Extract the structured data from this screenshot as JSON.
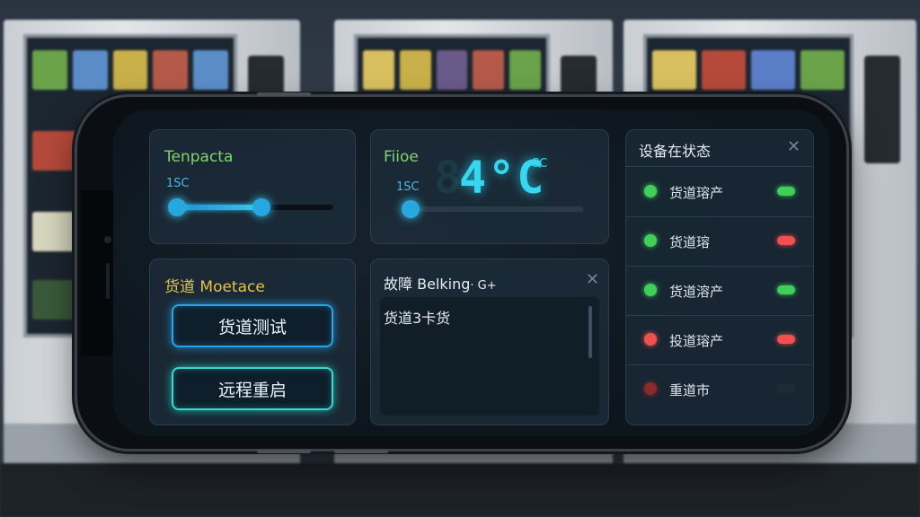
{
  "temp_panel": {
    "title": "Tenpacta",
    "value_label": "1SC",
    "slider_level": 0.48
  },
  "display_panel": {
    "title": "Fiioe",
    "value_label": "1SC",
    "temp_display": "4°C",
    "unit": "CC",
    "slider_level": 0.0
  },
  "channel_panel": {
    "title": "货道 Moetace",
    "test_button": "货道测试",
    "restart_button": "远程重启"
  },
  "fault_panel": {
    "title": "故障 Belking",
    "title_suffix": "· G+",
    "message": "货道3卡货"
  },
  "status_panel": {
    "title": "设备在状态",
    "items": [
      {
        "label": "货道瑢产",
        "dot_color": "#3fd05a",
        "pill_color": "#3fd05a"
      },
      {
        "label": "货道瑢",
        "dot_color": "#3fd05a",
        "pill_color": "#f05050"
      },
      {
        "label": "货道溶产",
        "dot_color": "#3fd05a",
        "pill_color": "#3fd05a"
      },
      {
        "label": "投道瑢产",
        "dot_color": "#f05050",
        "pill_color": "#f05050"
      },
      {
        "label": "重道市",
        "dot_color": "#8a2a2a",
        "pill_color": "#1f2a33"
      }
    ]
  }
}
